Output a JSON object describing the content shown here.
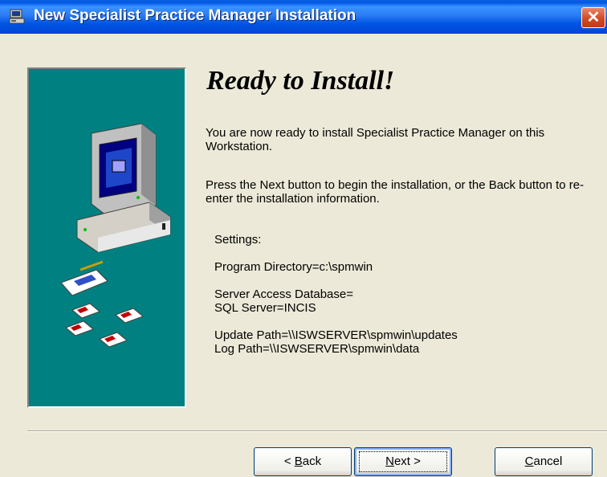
{
  "window": {
    "title": "New Specialist Practice Manager Installation",
    "close_glyph": "✕",
    "icon": "installer-app-icon"
  },
  "main": {
    "heading": "Ready to Install!",
    "paragraph1": "You are now ready to install Specialist Practice Manager on this Workstation.",
    "paragraph2": "Press the Next button to begin the installation, or the Back button to re-enter the installation information.",
    "settings": {
      "label": "Settings:",
      "program_directory": "Program Directory=c:\\spmwin",
      "server_db": "Server Access Database=",
      "sql_server": "SQL Server=INCIS",
      "update_path": "Update Path=\\\\ISWSERVER\\spmwin\\updates",
      "log_path": "Log Path=\\\\ISWSERVER\\spmwin\\data"
    }
  },
  "buttons": {
    "back_prefix": "< ",
    "back_accel": "B",
    "back_rest": "ack",
    "next_accel": "N",
    "next_rest": "ext >",
    "cancel_accel": "C",
    "cancel_rest": "ancel"
  },
  "colors": {
    "titlebar": "#0054E3",
    "panel": "#008080",
    "dialog_bg": "#ECE9D8"
  }
}
